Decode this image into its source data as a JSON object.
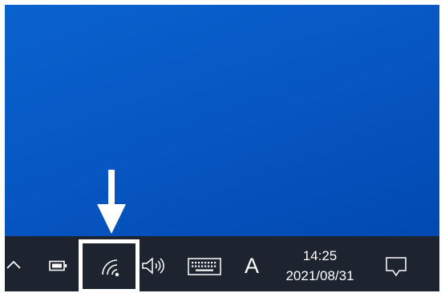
{
  "desktop": {
    "background_color": "#0759c7"
  },
  "taskbar": {
    "background_color": "#1d2430",
    "tray_icons": [
      "chevron-up-icon",
      "battery-icon",
      "network-icon",
      "volume-icon",
      "touch-keyboard-icon"
    ],
    "input_indicator": "A",
    "clock": {
      "time": "14:25",
      "date": "2021/08/31"
    },
    "notification_icon": "notification-icon"
  },
  "annotation": {
    "highlight_color": "#ffffff",
    "arrow_color": "#ffffff"
  }
}
